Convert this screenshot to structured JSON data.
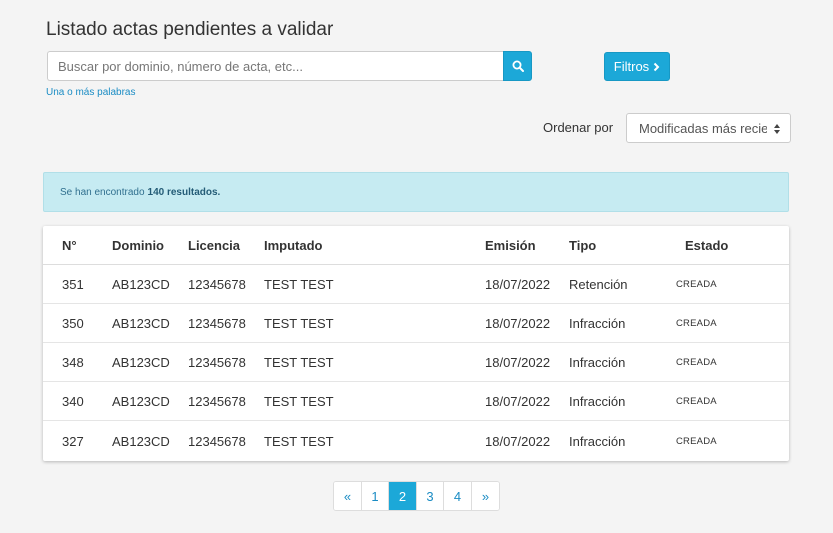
{
  "header": {
    "title": "Listado actas pendientes a validar"
  },
  "search": {
    "placeholder": "Buscar por dominio, número de acta, etc...",
    "value": "",
    "hint": "Una o más palabras",
    "button_icon": "search-icon"
  },
  "filters": {
    "label": "Filtros",
    "icon": "chevron-right-icon"
  },
  "sort": {
    "label": "Ordenar por",
    "selected": "Modificadas más recientes"
  },
  "results": {
    "prefix": "Se han encontrado",
    "count_text": "140 resultados."
  },
  "table": {
    "columns": [
      "N°",
      "Dominio",
      "Licencia",
      "Imputado",
      "Emisión",
      "Tipo",
      "Estado"
    ],
    "rows": [
      {
        "numero": "351",
        "dominio": "AB123CD",
        "licencia": "12345678",
        "imputado": "TEST TEST",
        "emision": "18/07/2022",
        "tipo": "Retención",
        "estado": "CREADA"
      },
      {
        "numero": "350",
        "dominio": "AB123CD",
        "licencia": "12345678",
        "imputado": "TEST TEST",
        "emision": "18/07/2022",
        "tipo": "Infracción",
        "estado": "CREADA"
      },
      {
        "numero": "348",
        "dominio": "AB123CD",
        "licencia": "12345678",
        "imputado": "TEST TEST",
        "emision": "18/07/2022",
        "tipo": "Infracción",
        "estado": "CREADA"
      },
      {
        "numero": "340",
        "dominio": "AB123CD",
        "licencia": "12345678",
        "imputado": "TEST TEST",
        "emision": "18/07/2022",
        "tipo": "Infracción",
        "estado": "CREADA"
      },
      {
        "numero": "327",
        "dominio": "AB123CD",
        "licencia": "12345678",
        "imputado": "TEST TEST",
        "emision": "18/07/2022",
        "tipo": "Infracción",
        "estado": "CREADA"
      }
    ]
  },
  "pagination": {
    "prev": "«",
    "pages": [
      "1",
      "2",
      "3",
      "4"
    ],
    "current": "2",
    "next": "»"
  },
  "colors": {
    "accent": "#1ca8d8",
    "alert_bg": "#c6ebf2",
    "alert_text": "#31708f",
    "link": "#1a8cc4"
  }
}
